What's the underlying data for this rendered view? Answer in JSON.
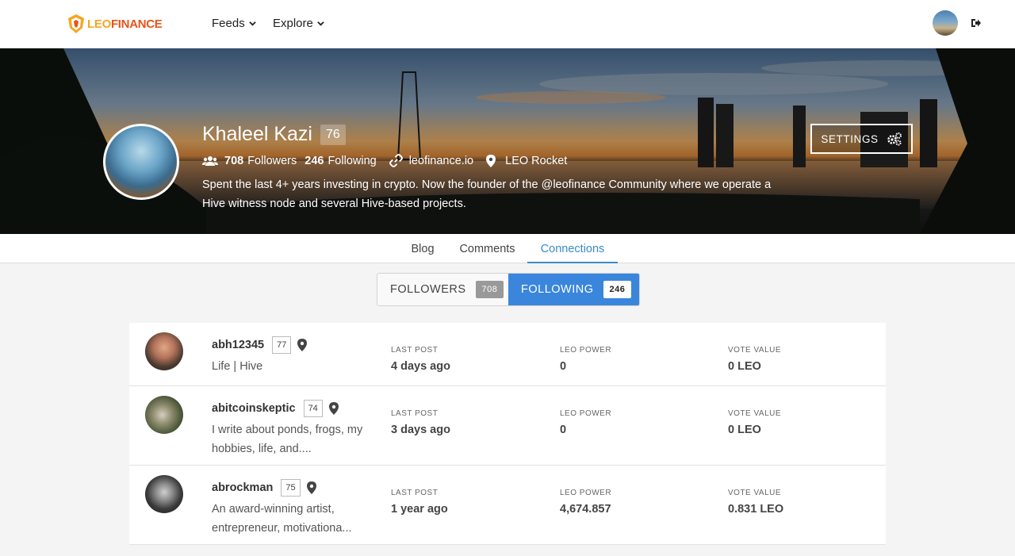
{
  "nav": {
    "logo_leo": "LEO",
    "logo_finance": "FINANCE",
    "feeds": "Feeds",
    "explore": "Explore"
  },
  "profile": {
    "name": "Khaleel Kazi",
    "reputation": "76",
    "followers_count": "708",
    "followers_label": "Followers",
    "following_count": "246",
    "following_label": "Following",
    "website": "leofinance.io",
    "location": "LEO Rocket",
    "bio": "Spent the last 4+ years investing in crypto. Now the founder of the @leofinance Community where we operate a Hive witness node and several Hive-based projects.",
    "settings_label": "SETTINGS"
  },
  "tabs": [
    "Blog",
    "Comments",
    "Connections"
  ],
  "toggle": {
    "followers_label": "FOLLOWERS",
    "followers_count": "708",
    "following_label": "FOLLOWING",
    "following_count": "246"
  },
  "columns": {
    "last_post": "LAST POST",
    "leo_power": "LEO POWER",
    "vote_value": "VOTE VALUE"
  },
  "rows": [
    {
      "name": "abh12345",
      "rep": "77",
      "bio": "Life | Hive",
      "last_post": "4 days ago",
      "leo_power": "0",
      "vote_value": "0 LEO"
    },
    {
      "name": "abitcoinskeptic",
      "rep": "74",
      "bio": "I write about ponds, frogs, my hobbies, life, and....",
      "last_post": "3 days ago",
      "leo_power": "0",
      "vote_value": "0 LEO"
    },
    {
      "name": "abrockman",
      "rep": "75",
      "bio": "An award-winning artist, entrepreneur, motivationa...",
      "last_post": "1 year ago",
      "leo_power": "4,674.857",
      "vote_value": "0.831 LEO"
    }
  ],
  "colors": {
    "accent": "#3a86dc",
    "tab_active": "#3a8cc9",
    "logo_orange": "#e8541a",
    "logo_yellow": "#f5a623"
  }
}
